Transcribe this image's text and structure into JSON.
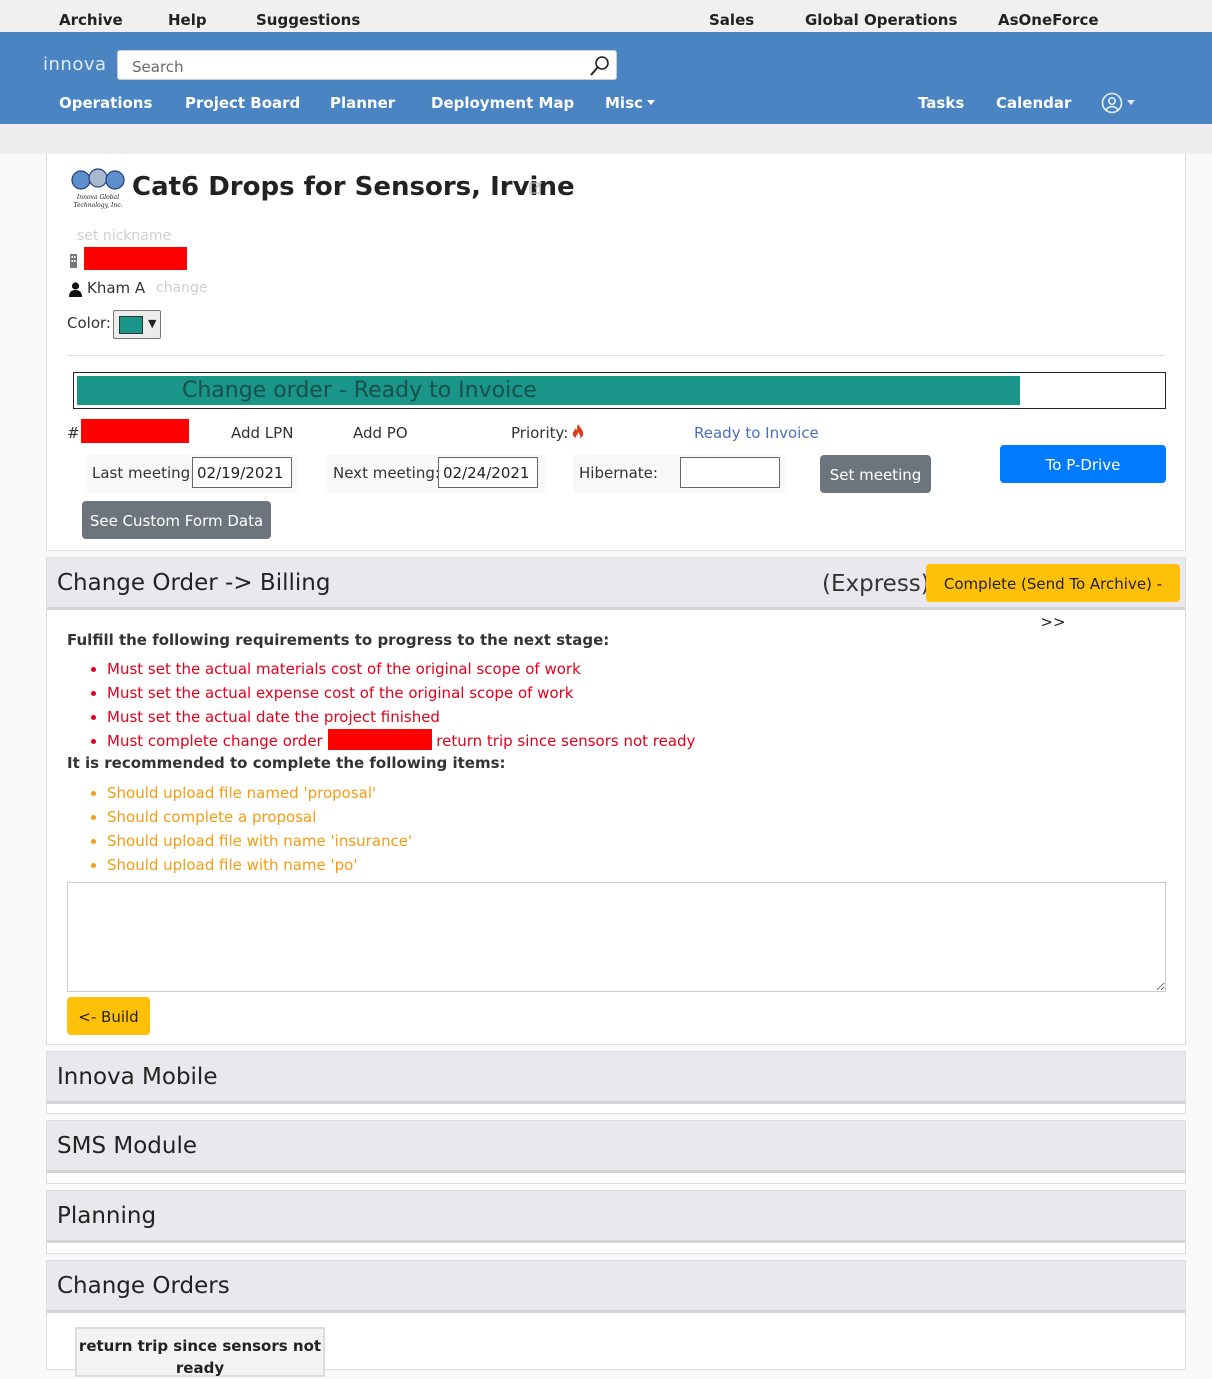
{
  "topbar": {
    "links": [
      "Archive",
      "Help",
      "Suggestions",
      "Sales",
      "Global Operations",
      "AsOneForce"
    ]
  },
  "header": {
    "brand": "innova",
    "search_placeholder": "Search",
    "nav": [
      "Operations",
      "Project Board",
      "Planner",
      "Deployment Map",
      "Misc",
      "Tasks",
      "Calendar"
    ]
  },
  "project": {
    "logo_text_line1": "Innova Global",
    "logo_text_line2": "Technology, Inc.",
    "title": "Cat6 Drops for Sensors, Irvine",
    "nickname_link": "set nickname",
    "owner": "Kham A",
    "owner_change": "change",
    "color_label": "Color:",
    "color_value": "#199589",
    "status_label": "Change order - Ready to Invoice",
    "hash": "#",
    "add_lpn": "Add LPN",
    "add_po": "Add PO",
    "priority_label": "Priority:",
    "ready_link": "Ready to Invoice",
    "last_meeting_label": "Last meeting:",
    "last_meeting": "02/19/2021",
    "next_meeting_label": "Next meeting:",
    "next_meeting": "02/24/2021",
    "hibernate_label": "Hibernate:",
    "hibernate": "",
    "set_meeting": "Set meeting",
    "to_pdrive": "To P-Drive",
    "custom_form": "See Custom Form Data"
  },
  "billing": {
    "heading": "Change Order -> Billing",
    "express": "(Express)",
    "complete_button": "Complete (Send To Archive) ->>",
    "requirements_title": "Fulfill the following requirements to progress to the next stage:",
    "requirements": [
      "Must set the actual materials cost of the original scope of work",
      "Must set the actual expense cost of the original scope of work",
      "Must set the actual date the project finished"
    ],
    "req_change_order_prefix": "Must complete change order",
    "req_change_order_suffix": "return trip since sensors not ready",
    "recommended_title": "It is recommended to complete the following items:",
    "recommended": [
      "Should upload file named 'proposal'",
      "Should complete a proposal",
      "Should upload file with name 'insurance'",
      "Should upload file with name 'po'"
    ],
    "notes": "",
    "back_button": "<- Build"
  },
  "sections": {
    "mobile": "Innova Mobile",
    "sms": "SMS Module",
    "planning": "Planning",
    "change_orders": "Change Orders"
  },
  "change_order_item": {
    "line1": "return trip since sensors not",
    "line2": "ready"
  }
}
